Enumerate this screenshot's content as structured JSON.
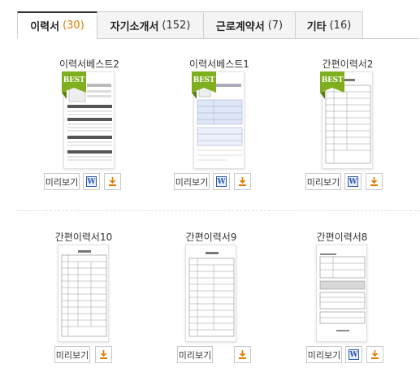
{
  "tabs": [
    {
      "label": "이력서",
      "count": "(30)",
      "active": true
    },
    {
      "label": "자기소개서",
      "count": "(152)",
      "active": false
    },
    {
      "label": "근로계약서",
      "count": "(7)",
      "active": false
    },
    {
      "label": "기타",
      "count": "(16)",
      "active": false
    }
  ],
  "badge_text": "BEST",
  "preview_label": "미리보기",
  "word_icon_glyph": "W",
  "cards": [
    {
      "title": "이력서베스트2",
      "best": true,
      "word": true,
      "hwp": true
    },
    {
      "title": "이력서베스트1",
      "best": true,
      "word": true,
      "hwp": true
    },
    {
      "title": "간편이력서2",
      "best": true,
      "word": true,
      "hwp": true
    },
    {
      "title": "간편이력서10",
      "best": false,
      "word": false,
      "hwp": true
    },
    {
      "title": "간편이력서9",
      "best": false,
      "word": false,
      "hwp": true
    },
    {
      "title": "간편이력서8",
      "best": false,
      "word": true,
      "hwp": true
    }
  ],
  "colors": {
    "accent_count": "#e07b00",
    "badge_green": "#7fae1f",
    "word_blue": "#2a5bb0",
    "hwp_orange": "#e07b00"
  }
}
